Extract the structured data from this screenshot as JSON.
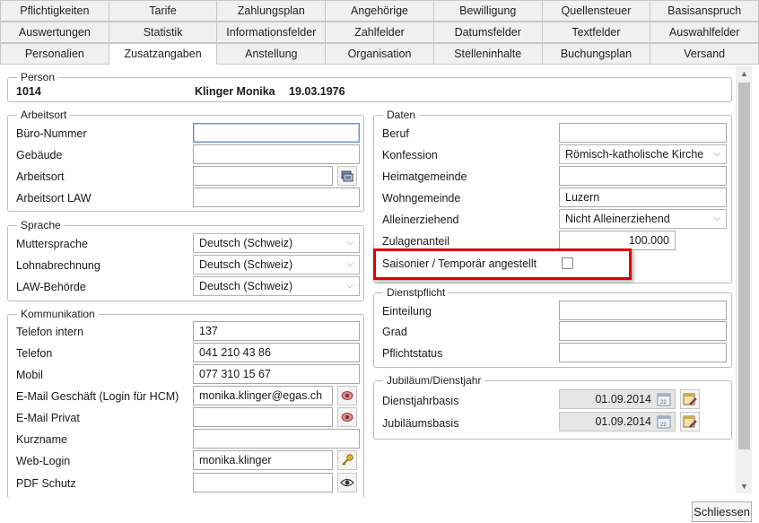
{
  "tabs": {
    "row1": [
      "Pflichtigkeiten",
      "Tarife",
      "Zahlungsplan",
      "Angehörige",
      "Bewilligung",
      "Quellensteuer",
      "Basisanspruch"
    ],
    "row2": [
      "Auswertungen",
      "Statistik",
      "Informationsfelder",
      "Zahlfelder",
      "Datumsfelder",
      "Textfelder",
      "Auswahlfelder"
    ],
    "row3": [
      "Personalien",
      "Zusatzangaben",
      "Anstellung",
      "Organisation",
      "Stelleninhalte",
      "Buchungsplan",
      "Versand"
    ],
    "active": "Zusatzangaben"
  },
  "person": {
    "label": "Person",
    "number": "1014",
    "name": "Klinger Monika",
    "birthdate": "19.03.1976"
  },
  "arbeitsort": {
    "label": "Arbeitsort",
    "buero_label": "Büro-Nummer",
    "buero_value": "",
    "gebaeude_label": "Gebäude",
    "gebaeude_value": "",
    "arbeitsort_label": "Arbeitsort",
    "arbeitsort_value": "",
    "law_label": "Arbeitsort LAW",
    "law_value": ""
  },
  "sprache": {
    "label": "Sprache",
    "mutter_label": "Muttersprache",
    "mutter_value": "Deutsch (Schweiz)",
    "lohn_label": "Lohnabrechnung",
    "lohn_value": "Deutsch (Schweiz)",
    "law_label": "LAW-Behörde",
    "law_value": "Deutsch (Schweiz)"
  },
  "kommunikation": {
    "label": "Kommunikation",
    "tel_intern_label": "Telefon intern",
    "tel_intern_value": "137",
    "telefon_label": "Telefon",
    "telefon_value": "041 210 43 86",
    "mobil_label": "Mobil",
    "mobil_value": "077 310 15 67",
    "email_g_label": "E-Mail Geschäft (Login für HCM)",
    "email_g_value": "monika.klinger@egas.ch",
    "email_p_label": "E-Mail Privat",
    "email_p_value": "",
    "kurzname_label": "Kurzname",
    "kurzname_value": "",
    "weblogin_label": "Web-Login",
    "weblogin_value": "monika.klinger",
    "pdf_label": "PDF Schutz",
    "pdf_value": ""
  },
  "daten": {
    "label": "Daten",
    "beruf_label": "Beruf",
    "beruf_value": "",
    "konfession_label": "Konfession",
    "konfession_value": "Römisch-katholische Kirche",
    "heimat_label": "Heimatgemeinde",
    "heimat_value": "",
    "wohn_label": "Wohngemeinde",
    "wohn_value": "Luzern",
    "allein_label": "Alleinerziehend",
    "allein_value": "Nicht Alleinerziehend",
    "zulagen_label": "Zulagenanteil",
    "zulagen_value": "100.000",
    "saison_label": "Saisonier / Temporär angestellt"
  },
  "dienstpflicht": {
    "label": "Dienstpflicht",
    "einteilung_label": "Einteilung",
    "einteilung_value": "",
    "grad_label": "Grad",
    "grad_value": "",
    "status_label": "Pflichtstatus",
    "status_value": ""
  },
  "jubilaeum": {
    "label": "Jubiläum/Dienstjahr",
    "dienst_label": "Dienstjahrbasis",
    "dienst_value": "01.09.2014",
    "jub_label": "Jubiläumsbasis",
    "jub_value": "01.09.2014"
  },
  "buttons": {
    "close": "Schliessen"
  },
  "colors": {
    "highlight": "#e00000",
    "focus_border": "#6d8ed1"
  }
}
